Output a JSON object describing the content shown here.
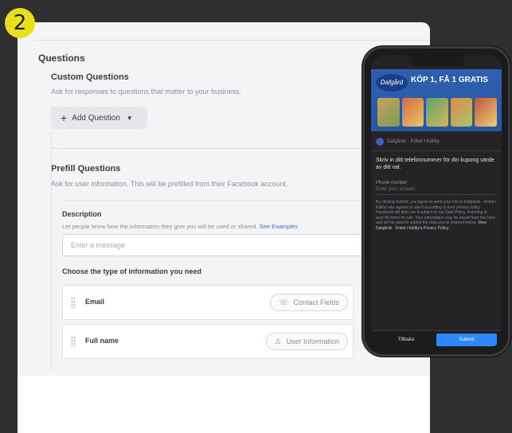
{
  "step_badge": "2",
  "questions": {
    "title": "Questions",
    "custom": {
      "title": "Custom Questions",
      "help": "Ask for responses to questions that matter to your business.",
      "add_button_label": "Add Question"
    },
    "prefill": {
      "title": "Prefill Questions",
      "help": "Ask for user information. This will be prefilled from their Facebook account.",
      "description": {
        "label": "Description",
        "help": "Let people know how the information they give you will be used or shared.",
        "link": "See Examples",
        "placeholder": "Enter a message"
      },
      "choose_label": "Choose the type of information you need",
      "fields": [
        {
          "name": "Email",
          "type": "Contact Fields"
        },
        {
          "name": "Full name",
          "type": "User Information"
        }
      ]
    }
  },
  "phone": {
    "brand": "Dafgård",
    "headline": "KÖP 1, FÅ 1 GRATIS",
    "advertiser": "Dafgårds · Köket i Källby",
    "ad_headline": "Skriv in ditt telefonnummer för din kupong värde av ditt val.",
    "field_label": "Phone number",
    "field_placeholder": "Enter your answer.",
    "legal_text": "By clicking Submit, you agree to send your info to Dafgårds · Köket i Källby who agrees to use it according to their privacy policy. Facebook will also use it subject to our Data Policy, including to auto-fill forms for ads. Your information may be saved from this form and will be used to submit the data you've entered below. ",
    "legal_link": "View Dafgårds · Köket i Källby's Privacy Policy.",
    "back_label": "Tillbaka",
    "submit_label": "Submit"
  },
  "colors": {
    "accent": "#2d88ff",
    "badge": "#e6e01a",
    "link": "#3b73c8"
  },
  "icons": [
    "plus-icon",
    "chevron-down-icon",
    "contact-card-icon",
    "user-icon",
    "drag-handle-icon"
  ]
}
